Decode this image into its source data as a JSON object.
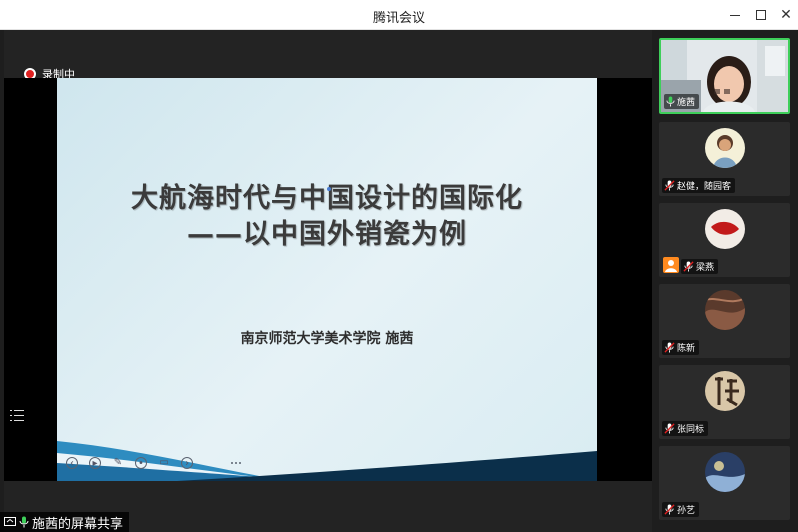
{
  "window": {
    "title": "腾讯会议"
  },
  "recording": {
    "label": "录制中"
  },
  "slide": {
    "title_line1": "大航海时代与中国设计的国际化",
    "title_line2": "——以中国外销瓷为例",
    "subtitle": "南京师范大学美术学院 施茜"
  },
  "share": {
    "label": "施茜的屏幕共享"
  },
  "participants": [
    {
      "name": "施茜",
      "mic": "on",
      "active": true
    },
    {
      "name": "赵健，随园客",
      "mic": "muted"
    },
    {
      "name": "梁燕",
      "mic": "muted",
      "host": true
    },
    {
      "name": "陈新",
      "mic": "muted"
    },
    {
      "name": "张同标",
      "mic": "muted"
    },
    {
      "name": "孙艺",
      "mic": "muted"
    }
  ],
  "colors": {
    "active_border": "#3ecf5a",
    "record": "#e02020",
    "host_badge": "#ff8a1f"
  }
}
